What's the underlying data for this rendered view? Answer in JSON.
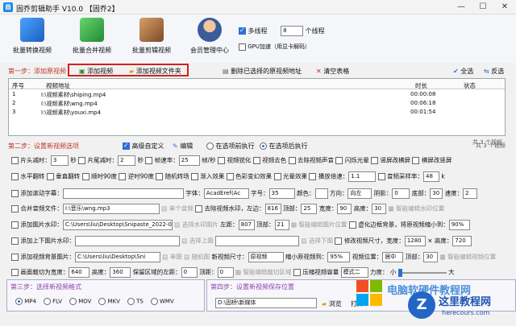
{
  "window": {
    "title": "固乔剪辑助手 V10.0 【固乔2】",
    "logo": "固"
  },
  "toolbar": {
    "items": [
      "批量转换视频",
      "批量合并视频",
      "批量剪辑视频",
      "会员管理中心"
    ]
  },
  "options": {
    "multithread": "多线程",
    "threads": "8",
    "threads_unit": "个线程",
    "gpu": "GPU加速（用显卡解码）"
  },
  "step1": {
    "label": "第一步：添加原视频",
    "add_video": "添加视频",
    "add_folder": "添加视频文件夹",
    "delete_selected": "删除已选择的原视频地址",
    "clear": "清空表格",
    "select_all": "全选",
    "reverse": "反选"
  },
  "table": {
    "headers": [
      "序号",
      "视频地址",
      "时长",
      "状态"
    ],
    "rows": [
      {
        "n": "1",
        "path": "I:\\视频素材\\shiping.mp4",
        "dur": "00:00:08",
        "st": ""
      },
      {
        "n": "2",
        "path": "I:\\视频素材\\wng.mp4",
        "dur": "00:06:18",
        "st": ""
      },
      {
        "n": "3",
        "path": "I:\\视频素材\\youxi.mp4",
        "dur": "00:01:54",
        "st": ""
      }
    ],
    "total": "共 3 个视频"
  },
  "step2": {
    "label": "第二步：设置新视频选项",
    "advanced": "高级自定义",
    "edit": "编辑",
    "before": "在选项前执行",
    "after": "在选项后执行",
    "total": "共 3 个视频"
  },
  "r1": {
    "head_cut": "片头减时：",
    "hv": "3",
    "sec1": "秒",
    "tail_cut": "片尾减时：",
    "tv": "2",
    "sec2": "秒",
    "fps_label": "帧速率：",
    "fps": "25",
    "fps_unit": "帧/秒",
    "opt1": "视频锐化",
    "opt2": "视频去色",
    "opt3": "去除视频声音",
    "opt4": "闪烁光晕",
    "opt5": "竖屏改横屏",
    "opt6": "横屏改竖屏"
  },
  "r2": {
    "o1": "水平翻转",
    "o2": "垂直翻转",
    "o3": "顺时90度",
    "o4": "逆时90度",
    "o5": "随机转场",
    "o6": "渐入效果",
    "o7": "色彩变幻效果",
    "o8": "光晕效果",
    "o9": "播放倍速：",
    "speed": "1.1",
    "o10": "音频采样率：",
    "rate": "48",
    "rate_unit": "k"
  },
  "r3": {
    "label": "添加滚动字幕：",
    "font": "字体：",
    "font_v": "AcadEref(Ac",
    "size": "字号：",
    "size_v": "35",
    "color": "颜色：",
    "dir": "方向：",
    "dir_v": "向左",
    "shadow": "阴影：",
    "shadow_v": "0",
    "bottom": "底部：",
    "bottom_v": "30",
    "speed": "速度：",
    "speed_v": "2"
  },
  "r4": {
    "label": "合并音频文件：",
    "path": "I:\\音乐\\wng.mp3",
    "single": "单个音频",
    "rm_wm": "去除视频水印，左边：",
    "left": "816",
    "top_l": "顶部：",
    "top": "25",
    "width_l": "宽度：",
    "width": "90",
    "height_l": "高度：",
    "height": "30",
    "smart": "智能编辑水印位置"
  },
  "r5": {
    "label": "添加图片水印：",
    "path": "C:\\Users\\liu\\Desktop\\Snipaste_2022-0",
    "pos": "选择水印图片",
    "left_l": "左距：",
    "left": "807",
    "top_l": "顶部：",
    "top": "21",
    "smart": "智能编辑图片位置",
    "blur": "虚化边框背景，将原视频缩小到：",
    "pct": "90%"
  },
  "r6": {
    "label": "添加上下图片水印：",
    "top_img": "选择上图",
    "bot_img": "选择下图",
    "mod": "修改视频尺寸，宽度：",
    "w": "1280",
    "x": "×",
    "hl": "高度：",
    "h": "720"
  },
  "r7": {
    "label": "添加视频背景图片：",
    "path": "C:\\Users\\liu\\Desktop\\Sni",
    "single": "单图",
    "random": "随机图",
    "size_l": "新视频尺寸：",
    "size_v": "原视频",
    "scale_l": "缩小原视频到：",
    "scale_v": "95%",
    "pos_l": "视频位置：",
    "pos_v": "居中",
    "top_l": "顶部：",
    "top_v": "30",
    "smart": "智能编辑视频位置"
  },
  "r8": {
    "label": "画面裁切为宽度：",
    "w": "640",
    "hl": "高度：",
    "h": "360",
    "keep": "保留区域的左距：",
    "left": "0",
    "top_l": "顶距：",
    "top": "0",
    "smart": "智能编辑裁切区域",
    "compress": "压缩视频容量",
    "mode": "模式二",
    "force": "力度：",
    "small": "小",
    "big": "大"
  },
  "step3": {
    "label": "第三步：选择新视频格式",
    "formats": [
      "MP4",
      "FLV",
      "MOV",
      "MKV",
      "TS",
      "WMV"
    ]
  },
  "step4": {
    "label": "第四步：设置新视频保存位置",
    "path": "D:\\固桥\\新媒体",
    "browse": "浏览",
    "open": "打开"
  },
  "watermark": {
    "site": "这里教程网",
    "url": "herecours.com",
    "text": "电脑软硬件教程网"
  },
  "colors": {
    "accent": "#2d6fd6",
    "step": "#c0392b",
    "purple": "#8e44ad"
  }
}
